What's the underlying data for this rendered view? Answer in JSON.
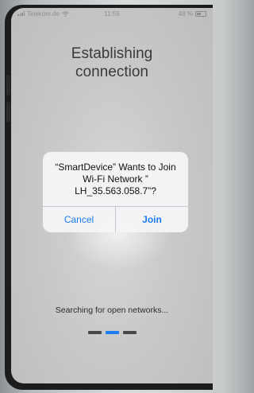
{
  "status_bar": {
    "carrier": "Telekom.de",
    "time": "11:56",
    "battery": "48 %"
  },
  "title": "Establishing connection",
  "dialog": {
    "message": "“SmartDevice” Wants to Join\nWi-Fi Network ”\nLH_35.563.058.7”?",
    "cancel_label": "Cancel",
    "join_label": "Join"
  },
  "status_text": "Searching for open networks...",
  "progress": {
    "total": 3,
    "active_index": 1
  },
  "colors": {
    "accent": "#1d7cf2",
    "dot": "#48484a"
  },
  "icons": [
    "signal-icon",
    "wifi-icon",
    "battery-icon"
  ]
}
